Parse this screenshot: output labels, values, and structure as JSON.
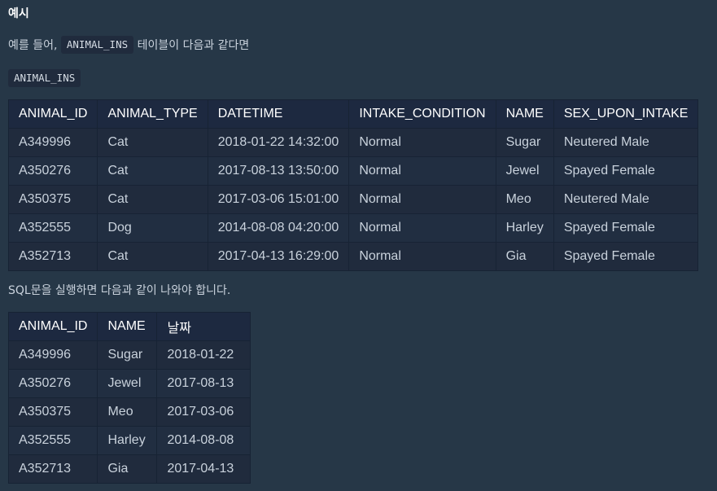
{
  "heading": "예시",
  "intro": {
    "prefix": "예를 들어,",
    "code": "ANIMAL_INS",
    "suffix": "테이블이 다음과 같다면"
  },
  "table_name_label": "ANIMAL_INS",
  "input_table": {
    "headers": [
      "ANIMAL_ID",
      "ANIMAL_TYPE",
      "DATETIME",
      "INTAKE_CONDITION",
      "NAME",
      "SEX_UPON_INTAKE"
    ],
    "rows": [
      [
        "A349996",
        "Cat",
        "2018-01-22 14:32:00",
        "Normal",
        "Sugar",
        "Neutered Male"
      ],
      [
        "A350276",
        "Cat",
        "2017-08-13 13:50:00",
        "Normal",
        "Jewel",
        "Spayed Female"
      ],
      [
        "A350375",
        "Cat",
        "2017-03-06 15:01:00",
        "Normal",
        "Meo",
        "Neutered Male"
      ],
      [
        "A352555",
        "Dog",
        "2014-08-08 04:20:00",
        "Normal",
        "Harley",
        "Spayed Female"
      ],
      [
        "A352713",
        "Cat",
        "2017-04-13 16:29:00",
        "Normal",
        "Gia",
        "Spayed Female"
      ]
    ]
  },
  "result_text": "SQL문을 실행하면 다음과 같이 나와야 합니다.",
  "output_table": {
    "headers": [
      "ANIMAL_ID",
      "NAME",
      "날짜"
    ],
    "rows": [
      [
        "A349996",
        "Sugar",
        "2018-01-22"
      ],
      [
        "A350276",
        "Jewel",
        "2017-08-13"
      ],
      [
        "A350375",
        "Meo",
        "2017-03-06"
      ],
      [
        "A352555",
        "Harley",
        "2014-08-08"
      ],
      [
        "A352713",
        "Gia",
        "2017-04-13"
      ]
    ]
  }
}
